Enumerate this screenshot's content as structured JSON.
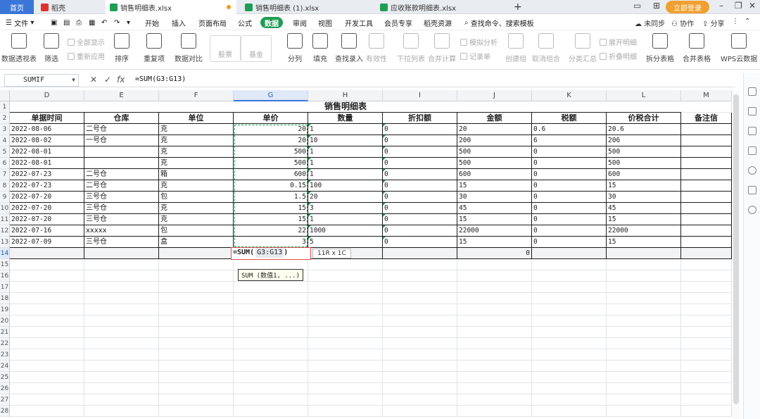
{
  "tabs": [
    {
      "label": "首页",
      "type": "home"
    },
    {
      "label": "稻壳",
      "type": "wps"
    },
    {
      "label": "销售明细表.xlsx",
      "type": "sheet",
      "active": true
    },
    {
      "label": "销售明细表 (1).xlsx",
      "type": "sheet"
    },
    {
      "label": "应收账款明细表.xlsx",
      "type": "sheet"
    }
  ],
  "new_tab": "+",
  "login": "立即登录",
  "menus": [
    "文件",
    "开始",
    "插入",
    "页面布局",
    "公式",
    "数据",
    "审阅",
    "视图",
    "开发工具",
    "会员专享",
    "稻壳资源"
  ],
  "active_menu": "数据",
  "search_cmd": "查找命令、搜索模板",
  "right_links": {
    "sync": "未同步",
    "collab": "协作",
    "share": "分享"
  },
  "ribbon": {
    "pivot": "数据透视表",
    "filter": "筛选",
    "show_all": "全部显示",
    "reapply": "重新应用",
    "sort": "排序",
    "dup": "重复项",
    "compare": "数据对比",
    "stock": "股票",
    "fund": "基金",
    "split": "分列",
    "fill": "填充",
    "lookup": "查找录入",
    "valid": "有效性",
    "dropdown": "下拉列表",
    "merge_calc": "合并计算",
    "simulate": "模拟分析",
    "record": "记录单",
    "group": "创建组",
    "ungroup": "取消组合",
    "subtotal": "分类汇总",
    "expand": "展开明细",
    "collapse": "折叠明细",
    "split_table": "拆分表格",
    "merge_table": "合并表格",
    "cloud": "WPS云数据"
  },
  "namebox": "SUMIF",
  "fx": "fx",
  "formula": "=SUM(G3:G13)",
  "columns": [
    "D",
    "E",
    "F",
    "G",
    "H",
    "I",
    "J",
    "K",
    "L",
    "M"
  ],
  "selected_column": "G",
  "title": "销售明细表",
  "headers": [
    "单据时间",
    "仓库",
    "单位",
    "单价",
    "数量",
    "折扣额",
    "金额",
    "税额",
    "价税合计",
    "备注信"
  ],
  "rows": [
    {
      "r": "3",
      "d": "2022-08-06",
      "e": "二号仓",
      "f": "克",
      "g": "20",
      "h": "1",
      "i": "0",
      "j": "20",
      "k": "0.6",
      "l": "20.6"
    },
    {
      "r": "4",
      "d": "2022-08-02",
      "e": "一号仓",
      "f": "克",
      "g": "20",
      "h": "10",
      "i": "0",
      "j": "200",
      "k": "6",
      "l": "206"
    },
    {
      "r": "5",
      "d": "2022-08-01",
      "e": "",
      "f": "克",
      "g": "500",
      "h": "1",
      "i": "0",
      "j": "500",
      "k": "0",
      "l": "500"
    },
    {
      "r": "6",
      "d": "2022-08-01",
      "e": "",
      "f": "克",
      "g": "500",
      "h": "1",
      "i": "0",
      "j": "500",
      "k": "0",
      "l": "500"
    },
    {
      "r": "7",
      "d": "2022-07-23",
      "e": "二号仓",
      "f": "箱",
      "g": "600",
      "h": "1",
      "i": "0",
      "j": "600",
      "k": "0",
      "l": "600"
    },
    {
      "r": "8",
      "d": "2022-07-23",
      "e": "二号仓",
      "f": "克",
      "g": "0.15",
      "h": "100",
      "i": "0",
      "j": "15",
      "k": "0",
      "l": "15"
    },
    {
      "r": "9",
      "d": "2022-07-20",
      "e": "三号仓",
      "f": "包",
      "g": "1.5",
      "h": "20",
      "i": "0",
      "j": "30",
      "k": "0",
      "l": "30"
    },
    {
      "r": "10",
      "d": "2022-07-20",
      "e": "三号仓",
      "f": "克",
      "g": "15",
      "h": "3",
      "i": "0",
      "j": "45",
      "k": "0",
      "l": "45"
    },
    {
      "r": "11",
      "d": "2022-07-20",
      "e": "三号仓",
      "f": "克",
      "g": "15",
      "h": "1",
      "i": "0",
      "j": "15",
      "k": "0",
      "l": "15"
    },
    {
      "r": "12",
      "d": "2022-07-16",
      "e": "xxxxx",
      "f": "包",
      "g": "22",
      "h": "1000",
      "i": "0",
      "j": "22000",
      "k": "0",
      "l": "22000"
    },
    {
      "r": "13",
      "d": "2022-07-09",
      "e": "三号仓",
      "f": "盒",
      "g": "3",
      "h": "5",
      "i": "0",
      "j": "15",
      "k": "0",
      "l": "15"
    }
  ],
  "row_numbers": [
    "1",
    "2",
    "3",
    "4",
    "5",
    "6",
    "7",
    "8",
    "9",
    "10",
    "11",
    "12",
    "13",
    "14",
    "15",
    "16",
    "17",
    "18",
    "19",
    "20",
    "21",
    "22",
    "23",
    "24",
    "25",
    "26",
    "27",
    "28"
  ],
  "active_row": "14",
  "edit": {
    "prefix": "=SUM(",
    "arg": "G3:G13",
    "suffix": ")"
  },
  "total_k": "0",
  "range_tip": "11R x 1C",
  "func_hint": "SUM (数值1, ...)"
}
